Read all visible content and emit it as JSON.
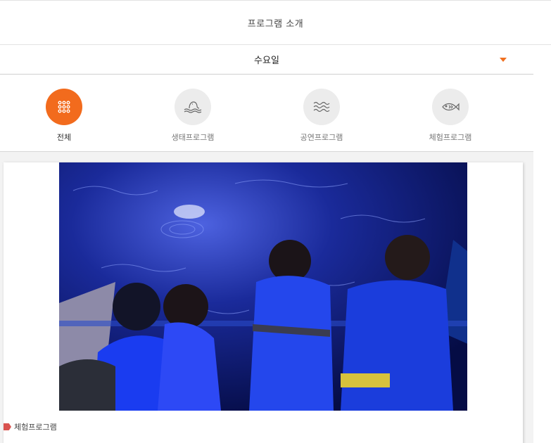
{
  "header": {
    "title": "프로그램 소개"
  },
  "day_select": {
    "value": "수요일"
  },
  "categories": [
    {
      "label": "전체",
      "icon": "grid-icon",
      "active": true
    },
    {
      "label": "생태프로그램",
      "icon": "seal-on-wave-icon",
      "active": false
    },
    {
      "label": "공연프로그램",
      "icon": "waves-icon",
      "active": false
    },
    {
      "label": "체험프로그램",
      "icon": "fish-icon",
      "active": false
    }
  ],
  "colors": {
    "accent": "#f26b1d",
    "tag": "#d9534f"
  },
  "card": {
    "photo_alt": "Children in blue life vests looking into the water",
    "tag_label": "체험프로그램"
  }
}
